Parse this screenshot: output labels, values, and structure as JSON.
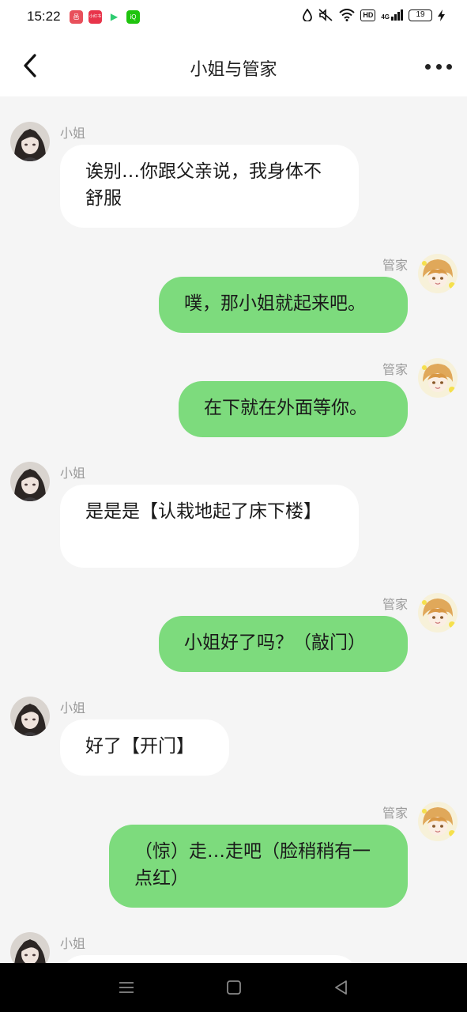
{
  "status_bar": {
    "time": "15:22",
    "apps": [
      {
        "icon": "app-icon-shopping",
        "color": "#e8505b",
        "label": "邑"
      },
      {
        "icon": "app-icon-redbook",
        "color": "#e8344a",
        "label": "小红书"
      },
      {
        "icon": "app-icon-video",
        "color": "#2ecc71",
        "label": "▶"
      },
      {
        "icon": "app-icon-iqiyi",
        "color": "#1fc40e",
        "label": "iQ"
      }
    ],
    "hd_badge": "HD",
    "network": "4G",
    "battery": "19"
  },
  "header": {
    "title": "小姐与管家",
    "back_icon": "chevron-left-icon",
    "more_icon": "more-horizontal-icon"
  },
  "messages": [
    {
      "side": "left",
      "sender": "小姐",
      "text": "诶别…你跟父亲说，我身体不舒服"
    },
    {
      "side": "right",
      "sender": "管家",
      "text": "噗，那小姐就起来吧。"
    },
    {
      "side": "right",
      "sender": "管家",
      "text": "在下就在外面等你。"
    },
    {
      "side": "left",
      "sender": "小姐",
      "text": "是是是【认栽地起了床下楼】"
    },
    {
      "side": "right",
      "sender": "管家",
      "text": "小姐好了吗？（敲门）"
    },
    {
      "side": "left",
      "sender": "小姐",
      "text": "好了【开门】"
    },
    {
      "side": "right",
      "sender": "管家",
      "text": "（惊）走…走吧（脸稍稍有一点红）"
    },
    {
      "side": "left",
      "sender": "小姐",
      "text": ""
    }
  ],
  "colors": {
    "right_bubble": "#7ddb7d",
    "left_bubble": "#ffffff",
    "chat_bg": "#f5f5f5"
  },
  "system_nav": {
    "menu_icon": "menu-icon",
    "home_icon": "home-square-icon",
    "back_icon": "back-triangle-icon"
  }
}
